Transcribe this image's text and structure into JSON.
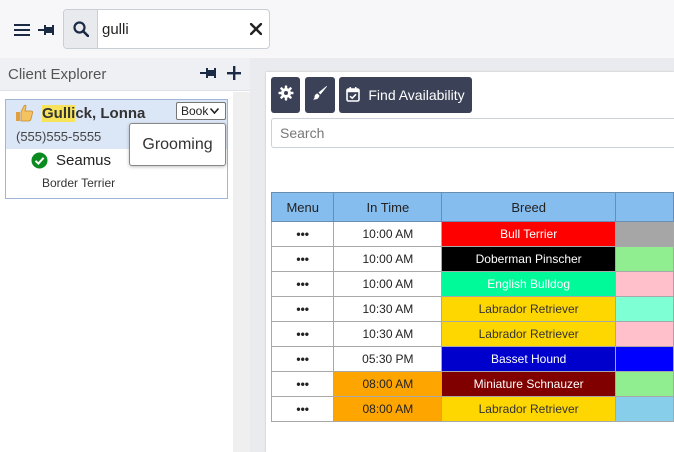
{
  "search": {
    "value": "gulli",
    "placeholder": ""
  },
  "explorer": {
    "title": "Client Explorer",
    "client": {
      "name_highlight": "Gulli",
      "name_rest": "ck, Lonna",
      "phone": "(555)555-5555",
      "book_label": "Book",
      "pet": {
        "name": "Seamus",
        "breed": "Border Terrier"
      }
    },
    "tooltip": "Grooming"
  },
  "toolbar": {
    "find_label": "Find Availability"
  },
  "grid": {
    "search_placeholder": "Search",
    "columns": [
      "Menu",
      "In Time",
      "Breed",
      ""
    ],
    "rows": [
      {
        "menu": "•••",
        "time": "10:00 AM",
        "time_bg": "#ffffff",
        "breed": "Bull Terrier",
        "breed_bg": "#ff0000",
        "breed_fg": "#ffffff",
        "extra_bg": "#a6a6a6"
      },
      {
        "menu": "•••",
        "time": "10:00 AM",
        "time_bg": "#ffffff",
        "breed": "Doberman Pinscher",
        "breed_bg": "#000000",
        "breed_fg": "#ffffff",
        "extra_bg": "#90ee90"
      },
      {
        "menu": "•••",
        "time": "10:00 AM",
        "time_bg": "#ffffff",
        "breed": "English Bulldog",
        "breed_bg": "#00fa9a",
        "breed_fg": "#ffffff",
        "extra_bg": "#ffc0cb"
      },
      {
        "menu": "•••",
        "time": "10:30 AM",
        "time_bg": "#ffffff",
        "breed": "Labrador Retriever",
        "breed_bg": "#ffd700",
        "breed_fg": "#333333",
        "extra_bg": "#7fffd4"
      },
      {
        "menu": "•••",
        "time": "10:30 AM",
        "time_bg": "#ffffff",
        "breed": "Labrador Retriever",
        "breed_bg": "#ffd700",
        "breed_fg": "#333333",
        "extra_bg": "#ffc0cb"
      },
      {
        "menu": "•••",
        "time": "05:30 PM",
        "time_bg": "#ffffff",
        "breed": "Basset Hound",
        "breed_bg": "#0000cd",
        "breed_fg": "#ffffff",
        "extra_bg": "#0000ff"
      },
      {
        "menu": "•••",
        "time": "08:00 AM",
        "time_bg": "#ffa500",
        "breed": "Miniature Schnauzer",
        "breed_bg": "#800000",
        "breed_fg": "#ffffff",
        "extra_bg": "#90ee90"
      },
      {
        "menu": "•••",
        "time": "08:00 AM",
        "time_bg": "#ffa500",
        "breed": "Labrador Retriever",
        "breed_bg": "#ffd700",
        "breed_fg": "#333333",
        "extra_bg": "#87ceeb"
      }
    ]
  },
  "colors": {
    "accent": "#3b4157",
    "header_blue": "#86bdef",
    "highlight": "#f6e35a",
    "check_green": "#0a8a1f"
  }
}
